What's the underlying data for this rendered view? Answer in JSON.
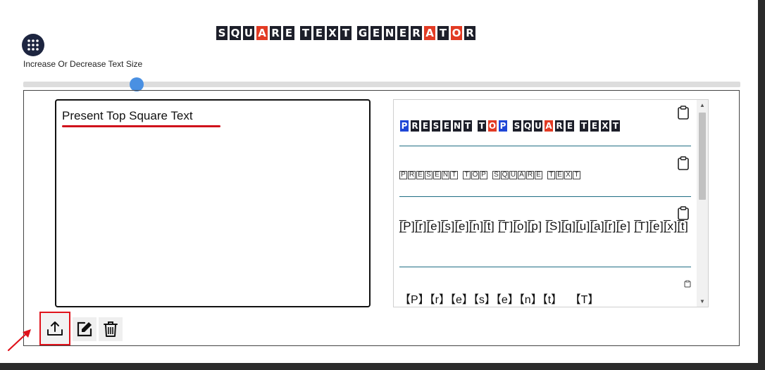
{
  "title": {
    "letters": [
      "S",
      "Q",
      "U",
      "A",
      "R",
      "E",
      " ",
      "T",
      "E",
      "X",
      "T",
      " ",
      "G",
      "E",
      "N",
      "E",
      "R",
      "A",
      "T",
      "O",
      "R"
    ],
    "red_indices": [
      3,
      17,
      19
    ]
  },
  "slider": {
    "label": "Increase Or Decrease Text Size",
    "value_percent": 15
  },
  "input": {
    "text": "Present Top Square Text"
  },
  "toolbar": {
    "upload": "upload-icon",
    "edit": "edit-icon",
    "delete": "trash-icon"
  },
  "outputs": {
    "style1": {
      "letters": [
        "P",
        "R",
        "E",
        "S",
        "E",
        "N",
        "T",
        " ",
        "T",
        "O",
        "P",
        " ",
        "S",
        "Q",
        "U",
        "A",
        "R",
        "E",
        " ",
        "T",
        "E",
        "X",
        "T"
      ],
      "blue_indices": [
        0,
        10
      ],
      "red_indices": [
        9,
        15
      ]
    },
    "style2": {
      "letters": [
        "P",
        "R",
        "E",
        "S",
        "E",
        "N",
        "T",
        " ",
        "T",
        "O",
        "P",
        " ",
        "S",
        "Q",
        "U",
        "A",
        "R",
        "E",
        " ",
        "T",
        "E",
        "X",
        "T"
      ]
    },
    "style3": {
      "text": "[̲̅P][̲̅r][̲̅e][̲̅s][̲̅e][̲̅n][̲̅t] [̲̅T][̲̅o][̲̅p] [̲̅S][̲̅q][̲̅u][̲̅a][̲̅r][̲̅e] [̲̅T][̲̅e][̲̅x][̲̅t]"
    },
    "style4": {
      "text": "【P】【r】【e】【s】【e】【n】【t】 【T】"
    }
  },
  "colors": {
    "tile_dark": "#1d1f2a",
    "tile_red": "#e23b24",
    "tile_blue": "#1f46d6",
    "accent_blue": "#4a90e2",
    "highlight_red": "#e0121b"
  }
}
